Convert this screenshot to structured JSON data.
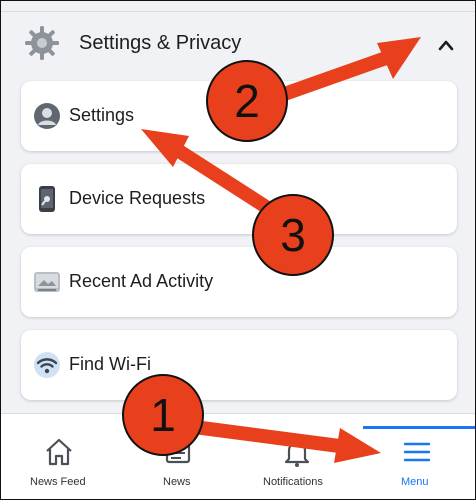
{
  "section": {
    "title": "Settings & Privacy",
    "gear_icon": "gear-icon",
    "collapse_icon": "chevron-up-icon"
  },
  "items": [
    {
      "label": "Settings",
      "icon": "user-circle-icon"
    },
    {
      "label": "Device Requests",
      "icon": "phone-key-icon"
    },
    {
      "label": "Recent Ad Activity",
      "icon": "ad-screen-icon"
    },
    {
      "label": "Find Wi-Fi",
      "icon": "wifi-icon"
    }
  ],
  "tabbar": {
    "tabs": [
      {
        "label": "News Feed",
        "icon": "home-icon"
      },
      {
        "label": "News",
        "icon": "news-icon"
      },
      {
        "label": "Notifications",
        "icon": "bell-icon"
      },
      {
        "label": "Menu",
        "icon": "menu-icon",
        "active": true
      }
    ]
  },
  "annotations": {
    "steps": [
      "1",
      "2",
      "3"
    ],
    "color": "#e8401c"
  },
  "colors": {
    "accent": "#1877f2",
    "background": "#f0f2f5"
  }
}
